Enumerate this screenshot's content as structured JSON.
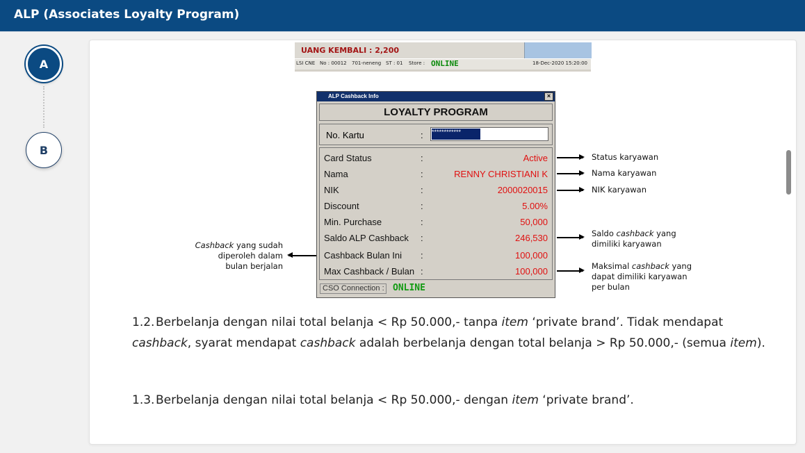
{
  "header": {
    "title": "ALP (Associates Loyalty Program)"
  },
  "steps": [
    {
      "label": "A"
    },
    {
      "label": "B"
    }
  ],
  "pos": {
    "change_label": "UANG KEMBALI : 2,200",
    "status": {
      "seg1": "LSI CNE",
      "seg2": "No : 00012",
      "seg3": "701-neneng",
      "seg4": "ST : 01",
      "seg5": "Store :",
      "online": "ONLINE",
      "datetime": "18-Dec-2020 15:20:00"
    }
  },
  "dialog": {
    "title": "ALP Cashback Info",
    "close_glyph": "×",
    "heading": "LOYALTY PROGRAM",
    "card_label": "No. Kartu",
    "colon": ":",
    "card_value": "************",
    "rows": [
      {
        "label": "Card Status",
        "value": "Active"
      },
      {
        "label": "Nama",
        "value": "RENNY CHRISTIANI K"
      },
      {
        "label": "NIK",
        "value": "2000020015"
      },
      {
        "label": "Discount",
        "value": "5.00%"
      },
      {
        "label": "Min. Purchase",
        "value": "50,000"
      },
      {
        "label": "Saldo ALP Cashback",
        "value": "246,530"
      },
      {
        "label": "Cashback Bulan Ini",
        "value": "100,000"
      },
      {
        "label": "Max Cashback / Bulan",
        "value": "100,000"
      }
    ],
    "footer_label": "CSO Connection :",
    "footer_status": "ONLINE"
  },
  "annotations": {
    "status": "Status karyawan",
    "nama": "Nama karyawan",
    "nik": "NIK karyawan",
    "saldo": {
      "pre": "Saldo ",
      "em": "cashback",
      "post": " yang",
      "line2": "dimiliki karyawan"
    },
    "max": {
      "pre": "Maksimal ",
      "em": "cashback",
      "post": " yang",
      "line2": "dapat dimiliki karyawan",
      "line3": "per bulan"
    },
    "left": {
      "em": "Cashback",
      "post": " yang sudah",
      "line2": "diperoleh dalam",
      "line3": "bulan berjalan"
    }
  },
  "paragraphs": {
    "p1": {
      "num": "1.2.",
      "t1": "Berbelanja dengan nilai total belanja < Rp 50.000,- tanpa ",
      "e1": "item",
      "t2": " ‘private brand’. Tidak mendapat ",
      "e2": "cashback",
      "t3": ", syarat mendapat ",
      "e3": "cashback",
      "t4": " adalah berbelanja dengan total belanja > Rp 50.000,- (semua ",
      "e4": "item",
      "t5": ")."
    },
    "p2": {
      "num": "1.3.",
      "t1": "Berbelanja dengan nilai total belanja < Rp 50.000,- dengan ",
      "e1": "item",
      "t2": " ‘private brand’."
    }
  }
}
